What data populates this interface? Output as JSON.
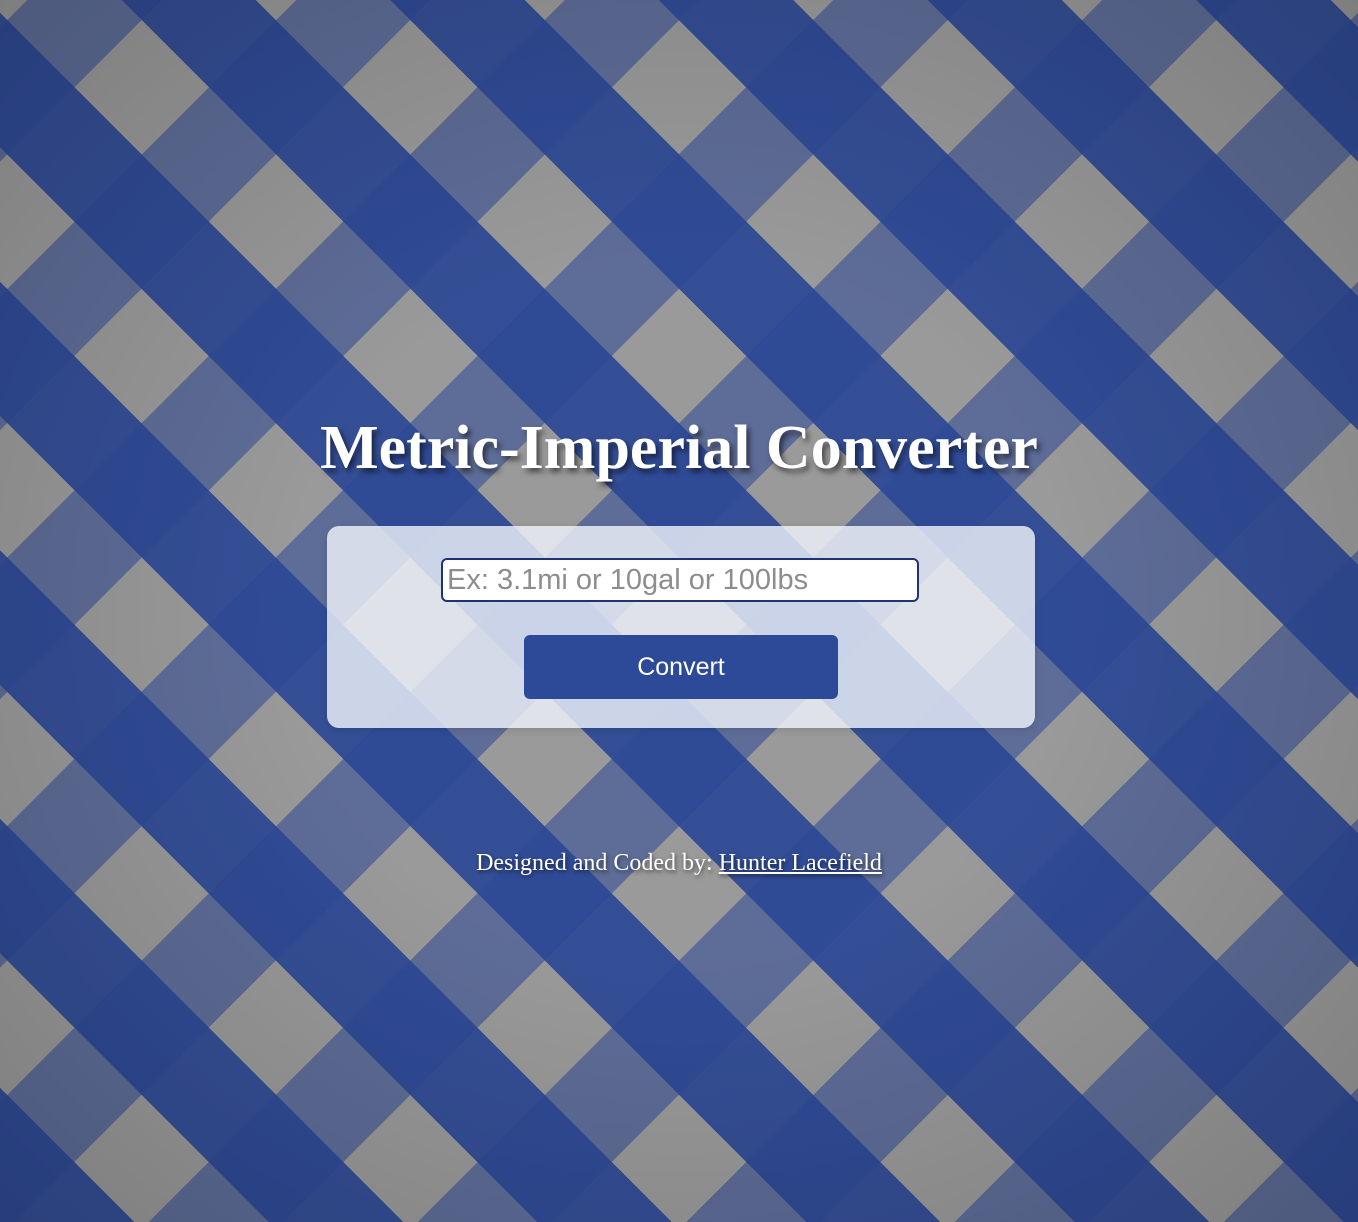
{
  "header": {
    "title": "Metric-Imperial Converter"
  },
  "converter": {
    "input_value": "",
    "input_placeholder": "Ex: 3.1mi or 10gal or 100lbs",
    "button_label": "Convert"
  },
  "footer": {
    "credit_prefix": "Designed and Coded by:",
    "author_link_label": "Hunter Lacefield"
  },
  "colors": {
    "accent": "#2c4a98",
    "pattern_blue": "#2c4896",
    "pattern_gray": "#9a9a9a",
    "card_background": "#eef1fa"
  }
}
